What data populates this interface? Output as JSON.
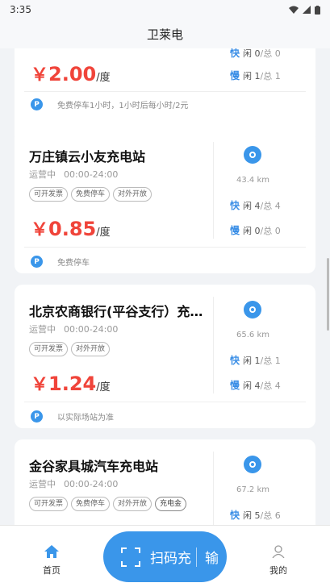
{
  "status_bar": {
    "time": "3:35"
  },
  "header": {
    "title": "卫莱电"
  },
  "partial_card": {
    "currency": "￥",
    "price": "2.00",
    "unit": "/度",
    "fast": {
      "kind": "快",
      "free_label": "闲",
      "free": "0",
      "total_label": "/总",
      "total": "0"
    },
    "slow": {
      "kind": "慢",
      "free_label": "闲",
      "free": "1",
      "total_label": "/总",
      "total": "1"
    },
    "parking_icon": "P",
    "parking": "免费停车1小时，1小时后每小时/2元"
  },
  "stations": [
    {
      "name": "万庄镇云小友充电站",
      "status": "运营中",
      "hours": "00:00-24:00",
      "tags": [
        "可开发票",
        "免费停车",
        "对外开放"
      ],
      "currency": "￥",
      "price": "0.85",
      "unit": "/度",
      "distance": "43.4 km",
      "fast": {
        "kind": "快",
        "free_label": "闲",
        "free": "4",
        "total_label": "/总",
        "total": "4"
      },
      "slow": {
        "kind": "慢",
        "free_label": "闲",
        "free": "0",
        "total_label": "/总",
        "total": "0"
      },
      "parking_icon": "P",
      "parking": "免费停车"
    },
    {
      "name": "北京农商银行(平谷支行）充电站",
      "status": "运营中",
      "hours": "00:00-24:00",
      "tags": [
        "可开发票",
        "对外开放"
      ],
      "currency": "￥",
      "price": "1.24",
      "unit": "/度",
      "distance": "65.6 km",
      "fast": {
        "kind": "快",
        "free_label": "闲",
        "free": "1",
        "total_label": "/总",
        "total": "1"
      },
      "slow": {
        "kind": "慢",
        "free_label": "闲",
        "free": "4",
        "total_label": "/总",
        "total": "4"
      },
      "parking_icon": "P",
      "parking": "以实际场站为准"
    },
    {
      "name": "金谷家具城汽车充电站",
      "status": "运营中",
      "hours": "00:00-24:00",
      "tags": [
        "可开发票",
        "免费停车",
        "对外开放",
        "充电金"
      ],
      "distance": "67.2 km",
      "fast": {
        "kind": "快",
        "free_label": "闲",
        "free": "5",
        "total_label": "/总",
        "total": "6"
      }
    }
  ],
  "bottom_nav": {
    "home": "首页",
    "scan": "扫码充",
    "scan_extra": "输",
    "mine": "我的"
  },
  "colors": {
    "accent": "#3a96ea",
    "price": "#f0443a"
  }
}
